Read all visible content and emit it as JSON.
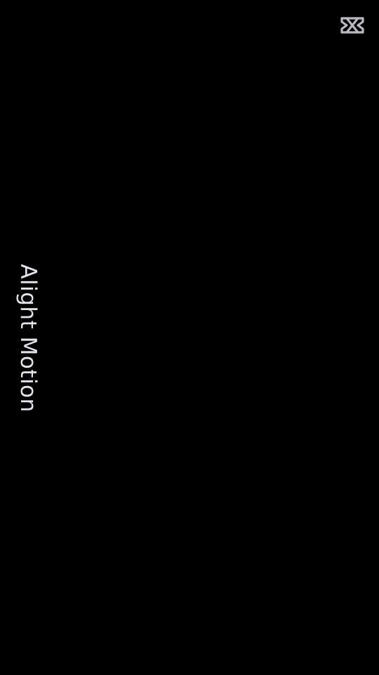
{
  "screen": {
    "background": "#000000"
  },
  "logo": {
    "icon": "capcut-logo-icon",
    "color": "#b9b9bf"
  },
  "overlay": {
    "text": "Alight Motion",
    "color": "#e4e4ea"
  }
}
